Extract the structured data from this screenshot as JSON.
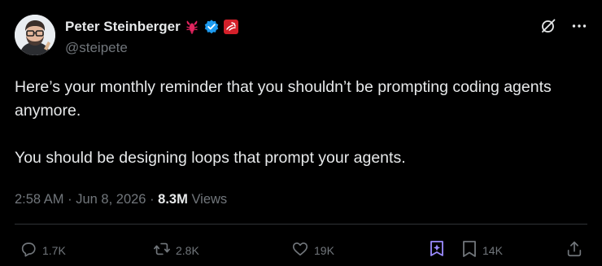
{
  "author": {
    "display_name": "Peter Steinberger",
    "handle": "@steipete",
    "avatar": "avatar-photo",
    "badges": [
      "lobster-icon",
      "verified-badge-icon",
      "affiliate-badge-icon"
    ]
  },
  "tweet": {
    "paragraphs": [
      "Here’s your monthly reminder that you shouldn’t be prompting coding agents anymore.",
      "You should be designing loops that prompt your agents."
    ],
    "time": "2:58 AM",
    "separator_1": "·",
    "date": "Jun 8, 2026",
    "separator_2": "·",
    "views_count": "8.3M",
    "views_label": "Views"
  },
  "actions": {
    "replies": "1.7K",
    "reposts": "2.8K",
    "likes": "19K",
    "bookmarks": "14K"
  },
  "colors": {
    "background": "#000000",
    "text": "#e7e9ea",
    "muted": "#71767b",
    "divider": "#2f3336",
    "verified_blue": "#1d9bf0",
    "grok_purple": "#9b8cff",
    "lobster_red": "#e0245e"
  }
}
